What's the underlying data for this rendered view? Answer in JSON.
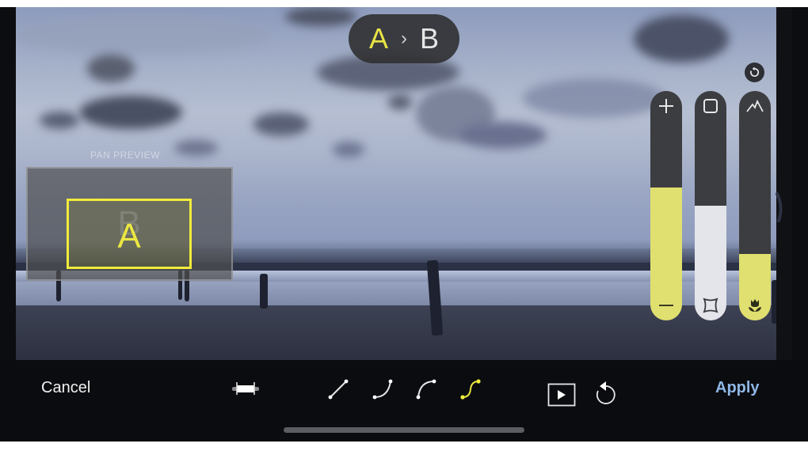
{
  "header": {
    "transition": {
      "from": "A",
      "separator": "›",
      "to": "B"
    }
  },
  "pan_preview": {
    "label": "PAN PREVIEW",
    "start_frame_label": "A",
    "end_frame_label": "B"
  },
  "sliders": [
    {
      "name": "zoom",
      "top_icon": "plus-icon",
      "bottom_icon": "minus-icon",
      "value_pct": 58,
      "color": "#e0e070"
    },
    {
      "name": "frame-size",
      "top_icon": "square-icon",
      "bottom_icon": "concave-square-icon",
      "value_pct": 50,
      "color": "#e4e5ea"
    },
    {
      "name": "focus-distance",
      "top_icon": "mountain-icon",
      "bottom_icon": "macro-flower-icon",
      "value_pct": 29,
      "color": "#e0e070"
    }
  ],
  "reset_icon": "reset-icon",
  "side_toggle_icon": "chevron-right-icon",
  "toolbar": {
    "cancel_label": "Cancel",
    "apply_label": "Apply",
    "duration_icon": "duration-bar-icon",
    "curves": [
      {
        "name": "linear",
        "selected": false
      },
      {
        "name": "ease-in",
        "selected": false
      },
      {
        "name": "ease-out",
        "selected": false
      },
      {
        "name": "ease-in-out",
        "selected": true
      }
    ],
    "play_icon": "play-preview-icon",
    "undo_icon": "undo-icon"
  },
  "colors": {
    "accent_yellow": "#f0ec3c",
    "apply_blue": "#8fb7e6",
    "toolbar_bg": "#0b0c10",
    "slider_track": "#3c3d40"
  }
}
